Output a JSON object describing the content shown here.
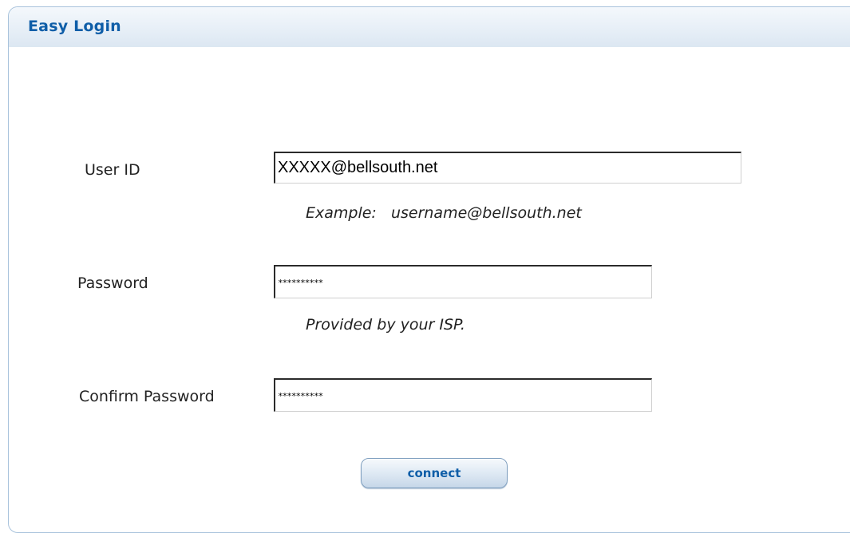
{
  "panel": {
    "title": "Easy Login"
  },
  "form": {
    "user_id": {
      "label": "User ID",
      "value": "XXXXX@bellsouth.net",
      "hint": "Example:   username@bellsouth.net"
    },
    "password": {
      "label": "Password",
      "value": "**********",
      "hint": "Provided by your ISP."
    },
    "confirm_password": {
      "label": "Confirm Password",
      "value": "**********"
    },
    "connect_label": "connect"
  },
  "colors": {
    "title": "#0f5ea8",
    "border": "#a9c3dc",
    "button_text": "#0f5ea8"
  }
}
